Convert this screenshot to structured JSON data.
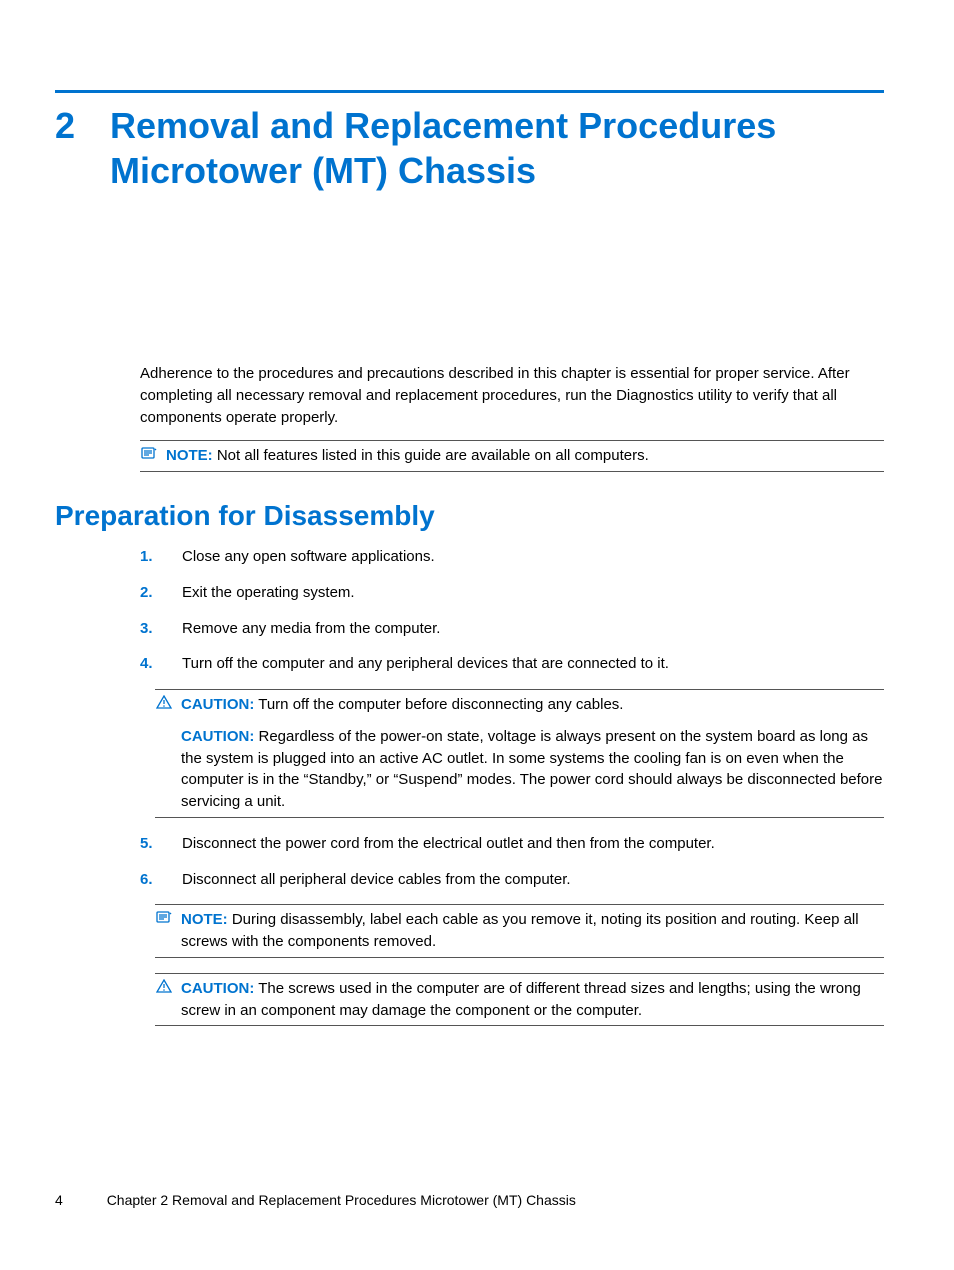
{
  "chapter": {
    "number": "2",
    "title": "Removal and Replacement Procedures Microtower (MT) Chassis"
  },
  "intro": "Adherence to the procedures and precautions described in this chapter is essential for proper service. After completing all necessary removal and replacement procedures, run the Diagnostics utility to verify that all components operate properly.",
  "note_top": {
    "label": "NOTE:",
    "text": "Not all features listed in this guide are available on all computers."
  },
  "section_heading": "Preparation for Disassembly",
  "steps": [
    "Close any open software applications.",
    "Exit the operating system.",
    "Remove any media from the computer.",
    "Turn off the computer and any peripheral devices that are connected to it.",
    "Disconnect the power cord from the electrical outlet and then from the computer.",
    "Disconnect all peripheral device cables from the computer."
  ],
  "caution_after4": {
    "label": "CAUTION:",
    "text1": "Turn off the computer before disconnecting any cables.",
    "label2": "CAUTION:",
    "text2": "Regardless of the power-on state, voltage is always present on the system board as long as the system is plugged into an active AC outlet. In some systems the cooling fan is on even when the computer is in the “Standby,” or “Suspend” modes. The power cord should always be disconnected before servicing a unit."
  },
  "note_after6": {
    "label": "NOTE:",
    "text": "During disassembly, label each cable as you remove it, noting its position and routing. Keep all screws with the components removed."
  },
  "caution_after6": {
    "label": "CAUTION:",
    "text": "The screws used in the computer are of different thread sizes and lengths; using the wrong screw in an component may damage the component or the computer."
  },
  "footer": {
    "page": "4",
    "text": "Chapter 2   Removal and Replacement Procedures Microtower (MT) Chassis"
  }
}
